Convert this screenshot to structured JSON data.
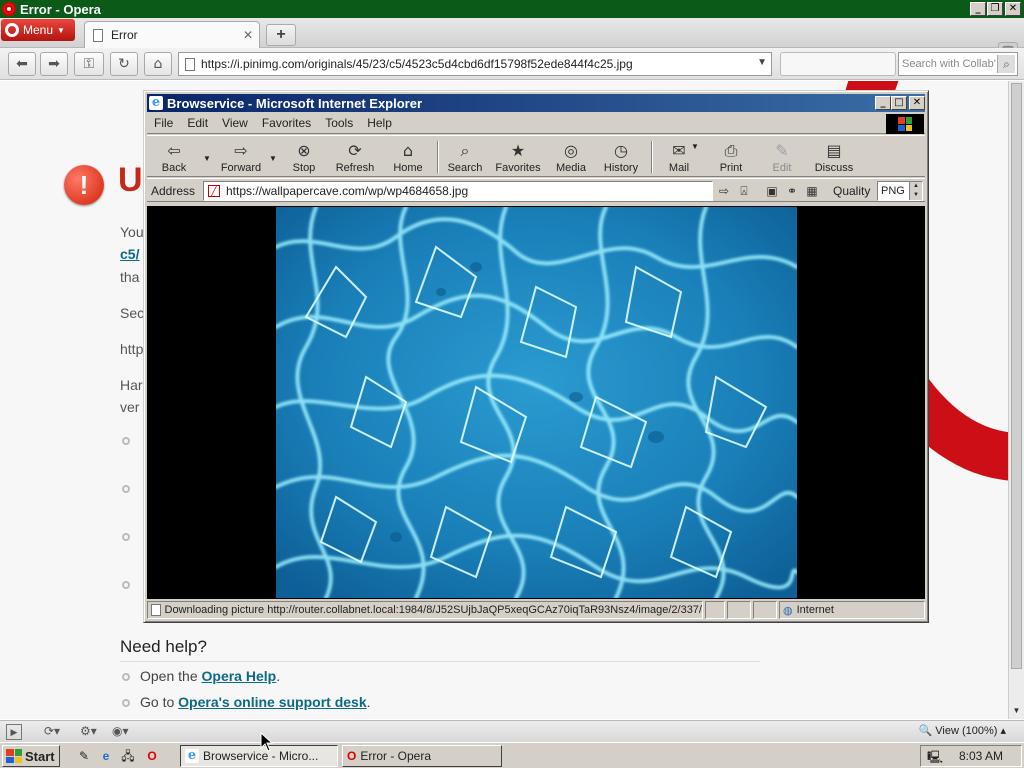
{
  "opera": {
    "window_title": "Error - Opera",
    "menu_label": "Menu",
    "tab_title": "Error",
    "new_tab_label": "+",
    "address": "https://i.pinimg.com/originals/45/23/c5/4523c5d4cbd6df15798f52ede844f4c25.jpg",
    "search_placeholder": "Search with Collab'",
    "page": {
      "heading_fragment": "U",
      "text_fragments": [
        "You",
        "c5/",
        "tha",
        "Sec",
        "http",
        "Har",
        "ver"
      ],
      "need_help": "Need help?",
      "help_lines": [
        {
          "prefix": "Open the ",
          "link": "Opera Help",
          "suffix": "."
        },
        {
          "prefix": "Go to ",
          "link": "Opera's online support desk",
          "suffix": "."
        }
      ]
    },
    "zoom_label": "View (100%)"
  },
  "ie": {
    "window_title": "Browservice - Microsoft Internet Explorer",
    "menus": [
      "File",
      "Edit",
      "View",
      "Favorites",
      "Tools",
      "Help"
    ],
    "toolbar": {
      "back": "Back",
      "forward": "Forward",
      "stop": "Stop",
      "refresh": "Refresh",
      "home": "Home",
      "search": "Search",
      "favorites": "Favorites",
      "media": "Media",
      "history": "History",
      "mail": "Mail",
      "print": "Print",
      "edit": "Edit",
      "discuss": "Discuss"
    },
    "address_label": "Address",
    "address": "https://wallpapercave.com/wp/wp4684658.jpg",
    "quality_label": "Quality",
    "quality_value": "PNG",
    "status_text": "Downloading picture http://router.collabnet.local:1984/8/J52SUjbJaQP5xeqGCAz70iqTaR93Nsz4/image/2/337/",
    "status_zone": "Internet"
  },
  "taskbar": {
    "start_label": "Start",
    "tasks": [
      {
        "label": "Browservice - Micro...",
        "active": true
      },
      {
        "label": "Error - Opera",
        "active": false
      }
    ],
    "clock": "8:03 AM"
  },
  "colors": {
    "opera_title": "#0b5a18",
    "opera_red": "#cc0f16",
    "ie_title_start": "#0a246a",
    "ie_title_end": "#3a6ea5",
    "win_face": "#d4d0c8",
    "link": "#0d6a86"
  }
}
